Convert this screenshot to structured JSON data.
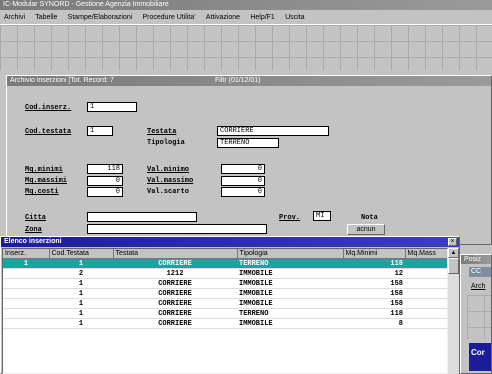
{
  "app": {
    "title": "IC-Modular SYNORD - Gestione Agenzia Immobiliare",
    "menu": [
      "Archivi",
      "Tabelle",
      "Stampe/Elaborazioni",
      "Procedure Utilita'",
      "Attivazione",
      "Help/F1",
      "Uscita"
    ]
  },
  "form": {
    "title": "Archivio inserzioni [Tot. Record: 7",
    "title_right": "Filtr (01/12/01)",
    "cod_inserz_label": "Cod.inserz.",
    "cod_inserz": "1",
    "cod_testata_label": "Cod.testata",
    "cod_testata": "1",
    "testata_label": "Testata",
    "testata": "CORRIERE",
    "tipologia_label": "Tipologia",
    "tipologia": "TERRENO",
    "mq_minimi_label": "Mq.minimi",
    "mq_minimi": "118",
    "mq_massimi_label": "Mq.massimi",
    "mq_massimi": "0",
    "mq_coste_label": "Mq.costi",
    "mq_coste": "0",
    "val_minimo_label": "Val.minimo",
    "val_minimo": "0",
    "val_massimo_label": "Val.massimo",
    "val_massimo": "0",
    "val_scarto_label": "Val.scarto",
    "val_scarto": "0",
    "citta_label": "Citta",
    "zona_label": "Zona",
    "prov_label": "Prov.",
    "prov": "MI",
    "nota_label": "Nota",
    "nota_btn": "acnun"
  },
  "list": {
    "title": "Elenco inserzioni",
    "columns": [
      "Inserz.",
      "Cod.Testata",
      "Testata",
      "Tipologia",
      "Mq.Minimi",
      "Mq.Mass"
    ],
    "rows": [
      {
        "inserz": "1",
        "cod": "1",
        "testata": "CORRIERE",
        "tipologia": "TERRENO",
        "minimi": "118",
        "mass": ""
      },
      {
        "inserz": "",
        "cod": "2",
        "testata": "1212",
        "tipologia": "IMMOBILE",
        "minimi": "12",
        "mass": ""
      },
      {
        "inserz": "",
        "cod": "1",
        "testata": "CORRIERE",
        "tipologia": "IMMOBILE",
        "minimi": "158",
        "mass": ""
      },
      {
        "inserz": "",
        "cod": "1",
        "testata": "CORRIERE",
        "tipologia": "IMMOBILE",
        "minimi": "158",
        "mass": ""
      },
      {
        "inserz": "",
        "cod": "1",
        "testata": "CORRIERE",
        "tipologia": "IMMOBILE",
        "minimi": "158",
        "mass": ""
      },
      {
        "inserz": "",
        "cod": "1",
        "testata": "CORRIERE",
        "tipologia": "TERRENO",
        "minimi": "118",
        "mass": ""
      },
      {
        "inserz": "",
        "cod": "1",
        "testata": "CORRIERE",
        "tipologia": "IMMOBILE",
        "minimi": "8",
        "mass": ""
      }
    ]
  },
  "side": {
    "title": "Posiz",
    "tab": "CC",
    "menu_item": "Arch",
    "label": "Cor"
  },
  "colors": {
    "selected_row": "#12a79f",
    "active_title": "#1c1c9a"
  }
}
